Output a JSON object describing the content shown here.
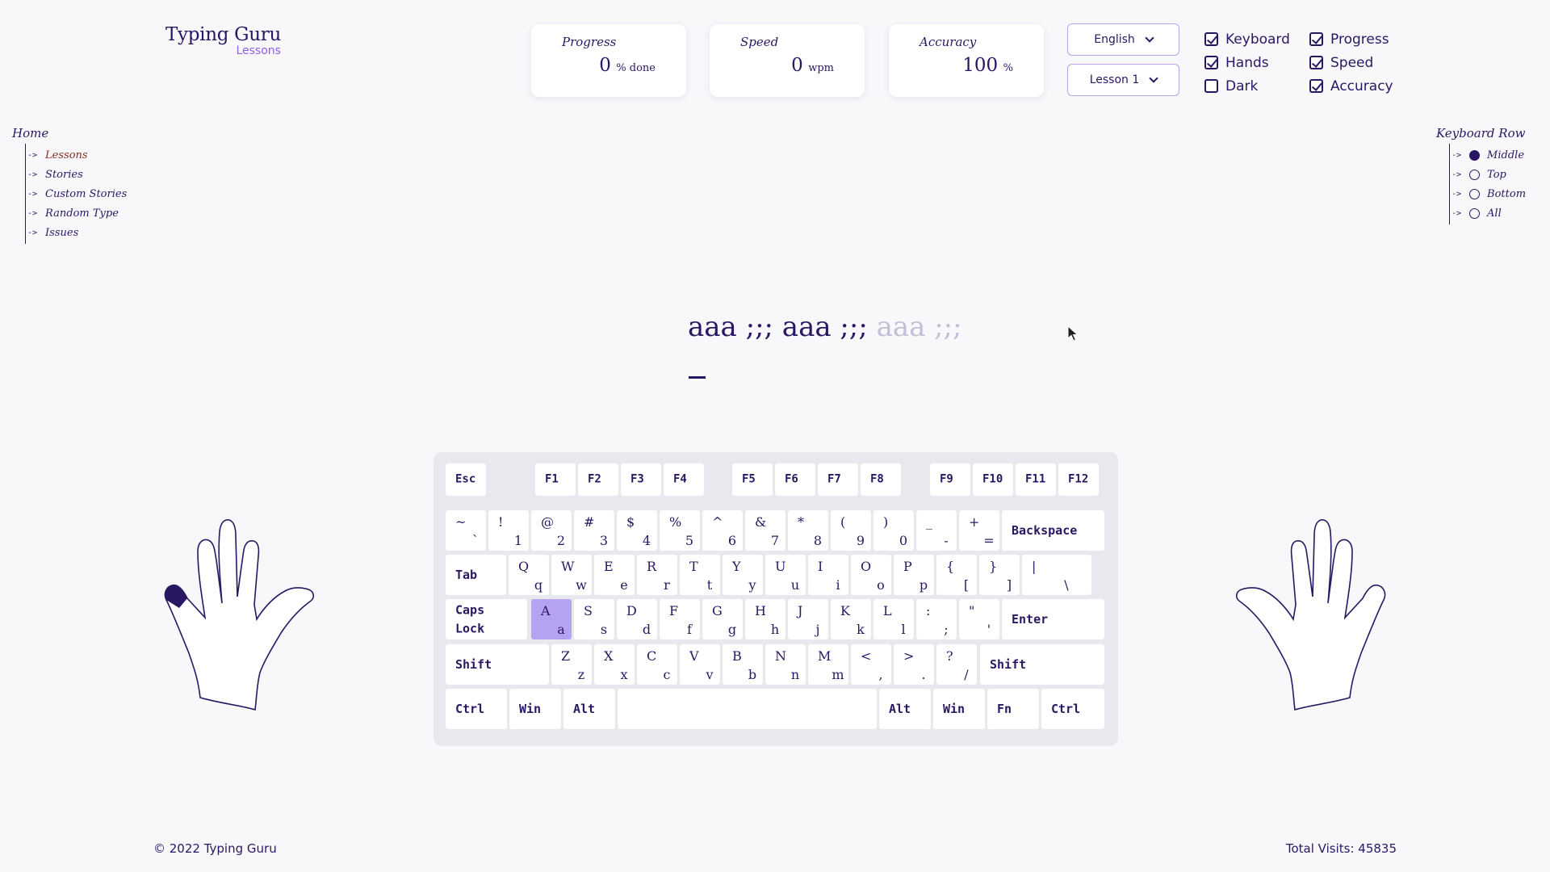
{
  "logo": {
    "title": "Typing Guru",
    "subtitle": "Lessons"
  },
  "stats": {
    "progress": {
      "label": "Progress",
      "value": "0",
      "unit": "% done"
    },
    "speed": {
      "label": "Speed",
      "value": "0",
      "unit": "wpm"
    },
    "accuracy": {
      "label": "Accuracy",
      "value": "100",
      "unit": "%"
    }
  },
  "selects": {
    "language": "English",
    "lesson": "Lesson 1"
  },
  "options": {
    "keyboard": {
      "label": "Keyboard",
      "checked": true
    },
    "hands": {
      "label": "Hands",
      "checked": true
    },
    "dark": {
      "label": "Dark",
      "checked": false
    },
    "progress": {
      "label": "Progress",
      "checked": true
    },
    "speed": {
      "label": "Speed",
      "checked": true
    },
    "accuracy": {
      "label": "Accuracy",
      "checked": true
    }
  },
  "nav": {
    "title": "Home",
    "items": [
      {
        "label": "Lessons",
        "active": true
      },
      {
        "label": "Stories"
      },
      {
        "label": "Custom Stories"
      },
      {
        "label": "Random Type"
      },
      {
        "label": "Issues"
      }
    ]
  },
  "keyboard_row": {
    "title": "Keyboard Row",
    "items": [
      {
        "label": "Middle",
        "selected": true
      },
      {
        "label": "Top"
      },
      {
        "label": "Bottom"
      },
      {
        "label": "All"
      }
    ]
  },
  "lesson": {
    "typed": "aaa ;;; aaa ;;; ",
    "pending": "aaa ;;;"
  },
  "keyboard": {
    "highlight_key": "A",
    "function_row": [
      "Esc",
      "F1",
      "F2",
      "F3",
      "F4",
      "F5",
      "F6",
      "F7",
      "F8",
      "F9",
      "F10",
      "F11",
      "F12"
    ],
    "number_row": [
      [
        "~",
        "`"
      ],
      [
        "!",
        "1"
      ],
      [
        "@",
        "2"
      ],
      [
        "#",
        "3"
      ],
      [
        "$",
        "4"
      ],
      [
        "%",
        "5"
      ],
      [
        "^",
        "6"
      ],
      [
        "&",
        "7"
      ],
      [
        "*",
        "8"
      ],
      [
        "(",
        "9"
      ],
      [
        ")",
        "0"
      ],
      [
        "_",
        "-"
      ],
      [
        "+",
        "="
      ]
    ],
    "backspace": "Backspace",
    "tab": "Tab",
    "qwerty_row": [
      [
        "Q",
        "q"
      ],
      [
        "W",
        "w"
      ],
      [
        "E",
        "e"
      ],
      [
        "R",
        "r"
      ],
      [
        "T",
        "t"
      ],
      [
        "Y",
        "y"
      ],
      [
        "U",
        "u"
      ],
      [
        "I",
        "i"
      ],
      [
        "O",
        "o"
      ],
      [
        "P",
        "p"
      ],
      [
        "{",
        "["
      ],
      [
        "}",
        "]"
      ],
      [
        "|",
        "\\"
      ]
    ],
    "caps": "Caps\nLock",
    "home_row": [
      [
        "A",
        "a"
      ],
      [
        "S",
        "s"
      ],
      [
        "D",
        "d"
      ],
      [
        "F",
        "f"
      ],
      [
        "G",
        "g"
      ],
      [
        "H",
        "h"
      ],
      [
        "J",
        "j"
      ],
      [
        "K",
        "k"
      ],
      [
        "L",
        "l"
      ],
      [
        ":",
        ";"
      ],
      [
        "\"",
        "'"
      ]
    ],
    "enter": "Enter",
    "shift": "Shift",
    "bottom_row": [
      [
        "Z",
        "z"
      ],
      [
        "X",
        "x"
      ],
      [
        "C",
        "c"
      ],
      [
        "V",
        "v"
      ],
      [
        "B",
        "b"
      ],
      [
        "N",
        "n"
      ],
      [
        "M",
        "m"
      ],
      [
        "<",
        ","
      ],
      [
        ">",
        "."
      ],
      [
        "?",
        "/"
      ]
    ],
    "ctrl": "Ctrl",
    "win": "Win",
    "alt": "Alt",
    "fn": "Fn"
  },
  "footer": {
    "copyright": "© 2022 Typing Guru",
    "visits": "Total Visits: 45835"
  },
  "colors": {
    "primary": "#2a1763",
    "accent": "#8f5fe8",
    "highlight": "#b6a2f2",
    "pending_text": "#c2bfd6"
  }
}
